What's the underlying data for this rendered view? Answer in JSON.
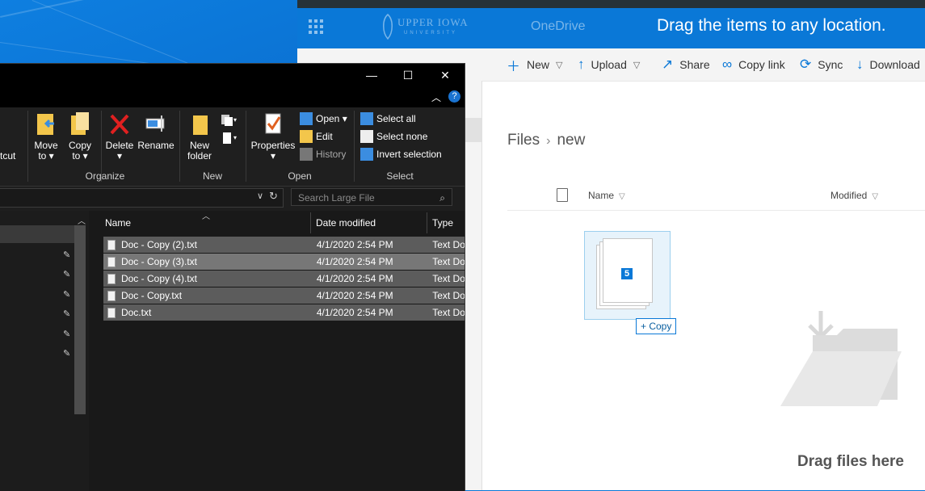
{
  "onedrive": {
    "logo_text": "UPPER IOWA",
    "logo_subtext": "UNIVERSITY",
    "app_name": "OneDrive",
    "banner": "Drag the items to any location.",
    "commands": [
      {
        "label": "New",
        "icon": "plus-icon",
        "chevron": true
      },
      {
        "label": "Upload",
        "icon": "upload-arrow-icon",
        "chevron": true
      },
      {
        "label": "Share",
        "icon": "share-icon",
        "chevron": false
      },
      {
        "label": "Copy link",
        "icon": "link-icon",
        "chevron": false
      },
      {
        "label": "Sync",
        "icon": "sync-icon",
        "chevron": false
      },
      {
        "label": "Download",
        "icon": "download-icon",
        "chevron": false
      }
    ],
    "breadcrumb": {
      "root": "Files",
      "current": "new"
    },
    "columns": {
      "name": "Name",
      "modified": "Modified"
    },
    "drag": {
      "count": "5",
      "tip": "Copy"
    },
    "dropzone_text": "Drag files here"
  },
  "explorer": {
    "window_buttons": {
      "minimize": "—",
      "maximize": "☐",
      "close": "✕"
    },
    "ribbon": {
      "cut_partial": "rtcut",
      "move_to": [
        "Move",
        "to ▾"
      ],
      "copy_to": [
        "Copy",
        "to ▾"
      ],
      "delete": [
        "Delete",
        "▾"
      ],
      "rename": "Rename",
      "new_folder": [
        "New",
        "folder"
      ],
      "properties": [
        "Properties",
        "▾"
      ],
      "open": "Open ▾",
      "edit": "Edit",
      "history": "History",
      "select_all": "Select all",
      "select_none": "Select none",
      "invert_selection": "Invert selection",
      "groups": {
        "organize": "Organize",
        "new": "New",
        "open": "Open",
        "select": "Select"
      }
    },
    "search_placeholder": "Search Large File",
    "columns": {
      "name": "Name",
      "date": "Date modified",
      "type": "Type"
    },
    "files": [
      {
        "name": "Doc - Copy (2).txt",
        "date": "4/1/2020 2:54 PM",
        "type": "Text Do"
      },
      {
        "name": "Doc - Copy (3).txt",
        "date": "4/1/2020 2:54 PM",
        "type": "Text Do"
      },
      {
        "name": "Doc - Copy (4).txt",
        "date": "4/1/2020 2:54 PM",
        "type": "Text Do"
      },
      {
        "name": "Doc - Copy.txt",
        "date": "4/1/2020 2:54 PM",
        "type": "Text Do"
      },
      {
        "name": "Doc.txt",
        "date": "4/1/2020 2:54 PM",
        "type": "Text Do"
      }
    ]
  },
  "colors": {
    "onedrive_blue": "#0a78d7",
    "explorer_bg": "#191919",
    "selection": "#777777"
  }
}
